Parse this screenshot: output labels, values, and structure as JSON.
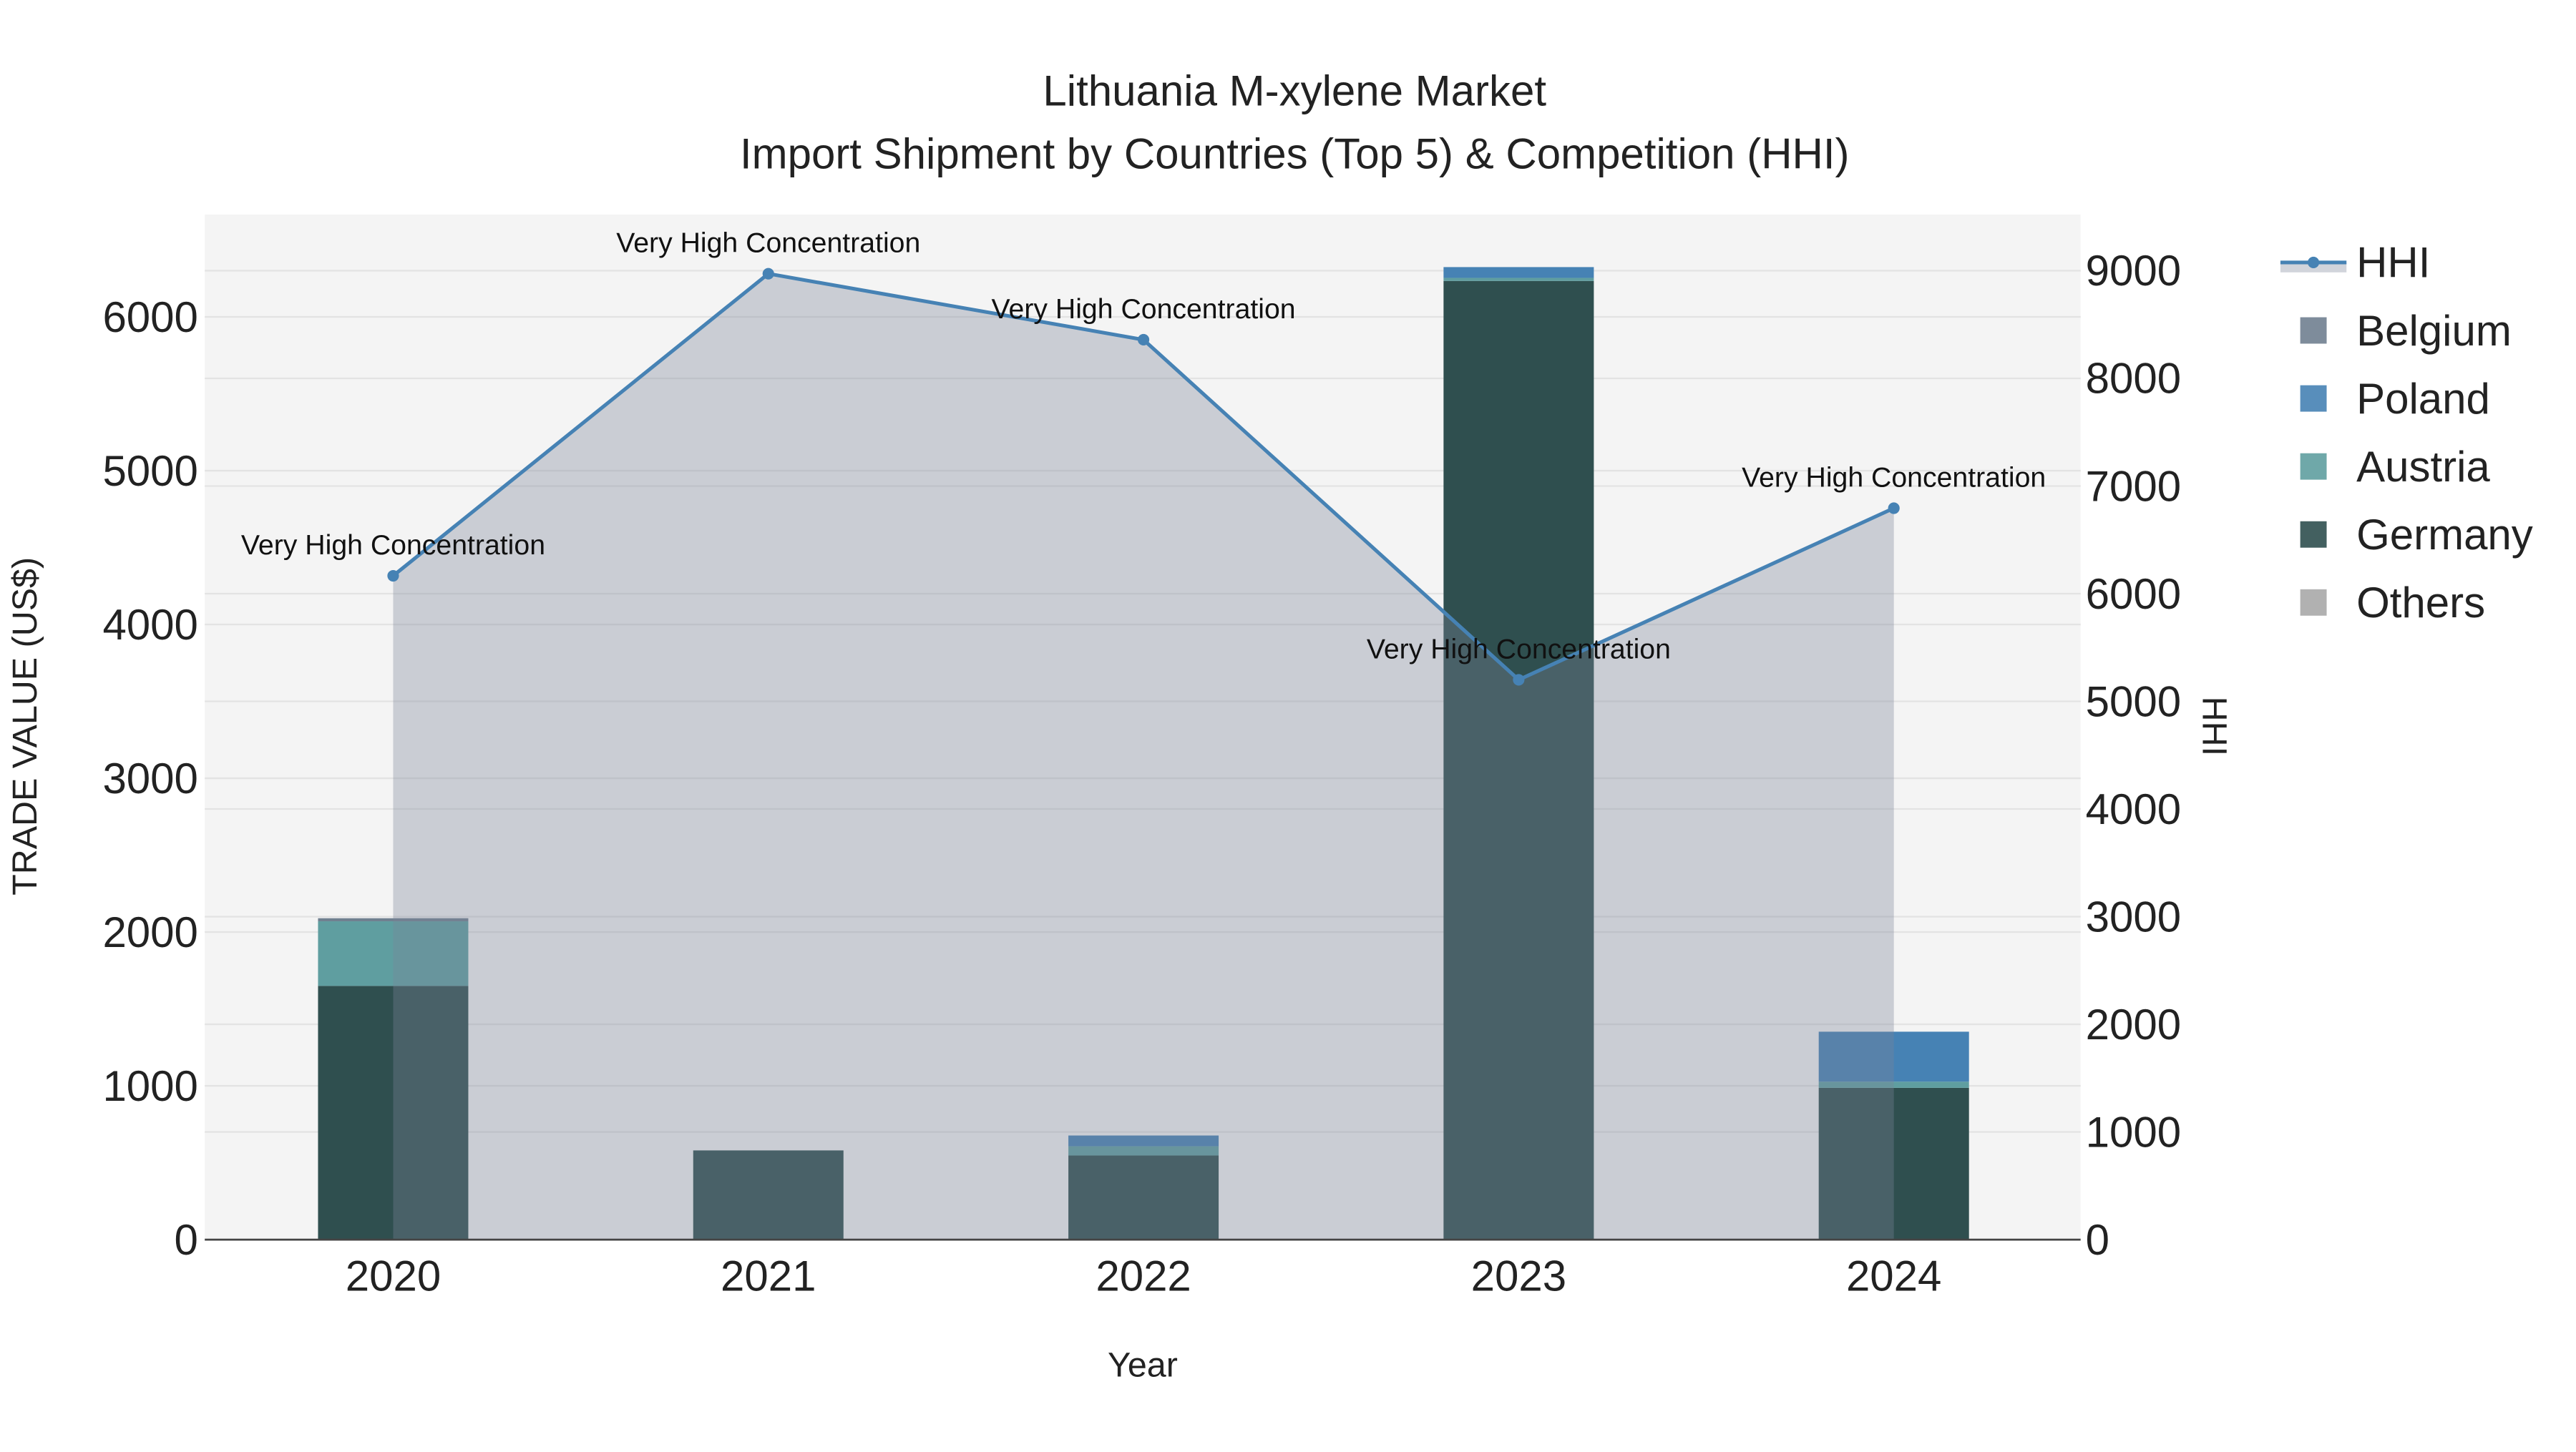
{
  "chart_data": {
    "type": "bar",
    "title": "Lithuania M-xylene Market",
    "subtitle": "Import Shipment by Countries (Top 5) & Competition (HHI)",
    "xlabel": "Year",
    "ylabel": "TRADE VALUE (US$)",
    "y2label": "HHI",
    "categories": [
      "2020",
      "2021",
      "2022",
      "2023",
      "2024"
    ],
    "ylim": [
      0,
      6600
    ],
    "y2lim": [
      0,
      9500
    ],
    "yticks": [
      0,
      1000,
      2000,
      3000,
      4000,
      5000,
      6000
    ],
    "y2ticks": [
      0,
      1000,
      2000,
      3000,
      4000,
      5000,
      6000,
      7000,
      8000,
      9000
    ],
    "stacked": true,
    "series": [
      {
        "name": "Germany",
        "color": "#2f4f4f",
        "values": [
          1650,
          580,
          547,
          6234,
          987
        ]
      },
      {
        "name": "Austria",
        "color": "#5f9ea0",
        "values": [
          420,
          0,
          60,
          20,
          40
        ]
      },
      {
        "name": "Poland",
        "color": "#4682b4",
        "values": [
          0,
          0,
          70,
          70,
          325
        ]
      },
      {
        "name": "Belgium",
        "color": "#708090",
        "values": [
          20,
          0,
          0,
          0,
          0
        ]
      },
      {
        "name": "Others",
        "color": "#a9a9a9",
        "values": [
          0,
          0,
          0,
          0,
          0
        ]
      }
    ],
    "hhi": {
      "name": "HHI",
      "color": "#4682b4",
      "values": [
        6166,
        8972,
        8359,
        5200,
        6794
      ],
      "labels": [
        "Very High Concentration",
        "Very High Concentration",
        "Very High Concentration",
        "Very High Concentration",
        "Very High Concentration"
      ]
    },
    "legend_order": [
      "HHI",
      "Belgium",
      "Poland",
      "Austria",
      "Germany",
      "Others"
    ],
    "legend_placement": "top-right",
    "grid": true
  }
}
